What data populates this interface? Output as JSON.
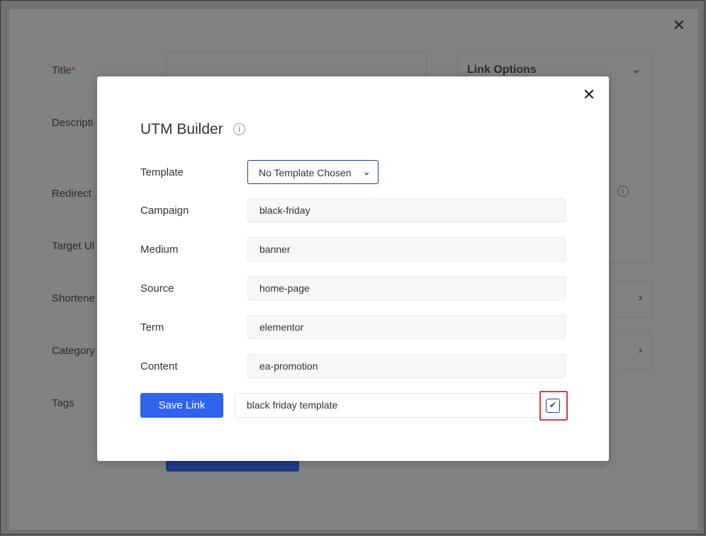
{
  "background": {
    "labels": {
      "title": "Title",
      "title_required": "*",
      "description": "Descripti",
      "redirect": "Redirect",
      "target_url": "Target Ul",
      "shortened": "Shortene",
      "category": "Category",
      "tags": "Tags"
    },
    "right_panel_title": "Link Options",
    "info_icon": "i",
    "close_glyph": "✕",
    "chevron_down": "⌄",
    "chevron_right": "›"
  },
  "modal": {
    "title": "UTM Builder",
    "title_info": "i",
    "close_glyph": "✕",
    "fields": {
      "template": {
        "label": "Template",
        "value": "No Template Chosen",
        "chevron": "⌄"
      },
      "campaign": {
        "label": "Campaign",
        "value": "black-friday"
      },
      "medium": {
        "label": "Medium",
        "value": "banner"
      },
      "source": {
        "label": "Source",
        "value": "home-page"
      },
      "term": {
        "label": "Term",
        "value": "elementor"
      },
      "content": {
        "label": "Content",
        "value": "ea-promotion"
      }
    },
    "save_button": "Save Link",
    "template_name_value": "black friday template",
    "confirm_glyph": "✔"
  },
  "colors": {
    "primary_button": "#2f64ef",
    "select_border": "#1d3f9a",
    "highlight": "#d93c3c"
  }
}
